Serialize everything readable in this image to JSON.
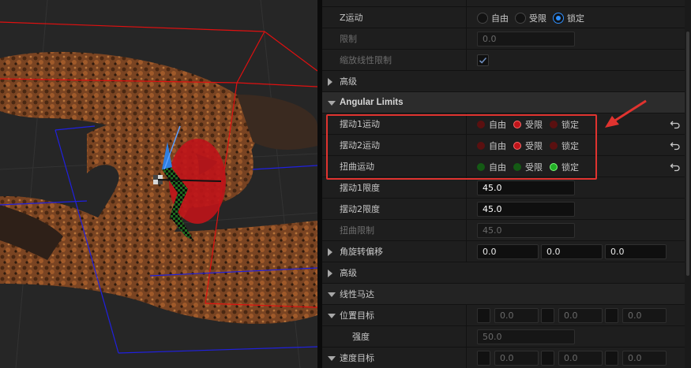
{
  "linear": {
    "z_motion": {
      "label": "Z运动",
      "options": [
        "自由",
        "受限",
        "锁定"
      ],
      "selected": 2
    },
    "limit": {
      "label": "限制",
      "value": "0.0"
    },
    "scale_limit": {
      "label": "缩放线性限制",
      "checked": true
    },
    "advanced": {
      "label": "高级"
    }
  },
  "angular": {
    "header": "Angular Limits",
    "swing1": {
      "label": "摆动1运动",
      "options": [
        "自由",
        "受限",
        "锁定"
      ],
      "selected": 1
    },
    "swing2": {
      "label": "摆动2运动",
      "options": [
        "自由",
        "受限",
        "锁定"
      ],
      "selected": 1
    },
    "twist": {
      "label": "扭曲运动",
      "options": [
        "自由",
        "受限",
        "锁定"
      ],
      "selected": 2
    },
    "swing1_limit": {
      "label": "摆动1限度",
      "value": "45.0"
    },
    "swing2_limit": {
      "label": "摆动2限度",
      "value": "45.0"
    },
    "twist_limit": {
      "label": "扭曲限制",
      "value": "45.0"
    },
    "rotation_offset": {
      "label": "角旋转偏移",
      "values": [
        "0.0",
        "0.0",
        "0.0"
      ]
    },
    "advanced": {
      "label": "高级"
    }
  },
  "linear_motor": {
    "header": "线性马达",
    "position_target": {
      "label": "位置目标",
      "values": [
        "0.0",
        "0.0",
        "0.0"
      ]
    },
    "strength": {
      "label": "强度",
      "value": "50.0"
    },
    "velocity_target": {
      "label": "速度目标",
      "values": [
        "0.0",
        "0.0",
        "0.0"
      ]
    }
  },
  "colors": {
    "accent": "#2e8fff",
    "annotation": "#e0332f",
    "swing_red": "#c0141a",
    "twist_green": "#22b026"
  },
  "icons": [
    "reset-arrow-icon",
    "expand-arrow-icon",
    "collapse-arrow-icon",
    "checkmark-icon",
    "annotation-arrow-icon"
  ]
}
